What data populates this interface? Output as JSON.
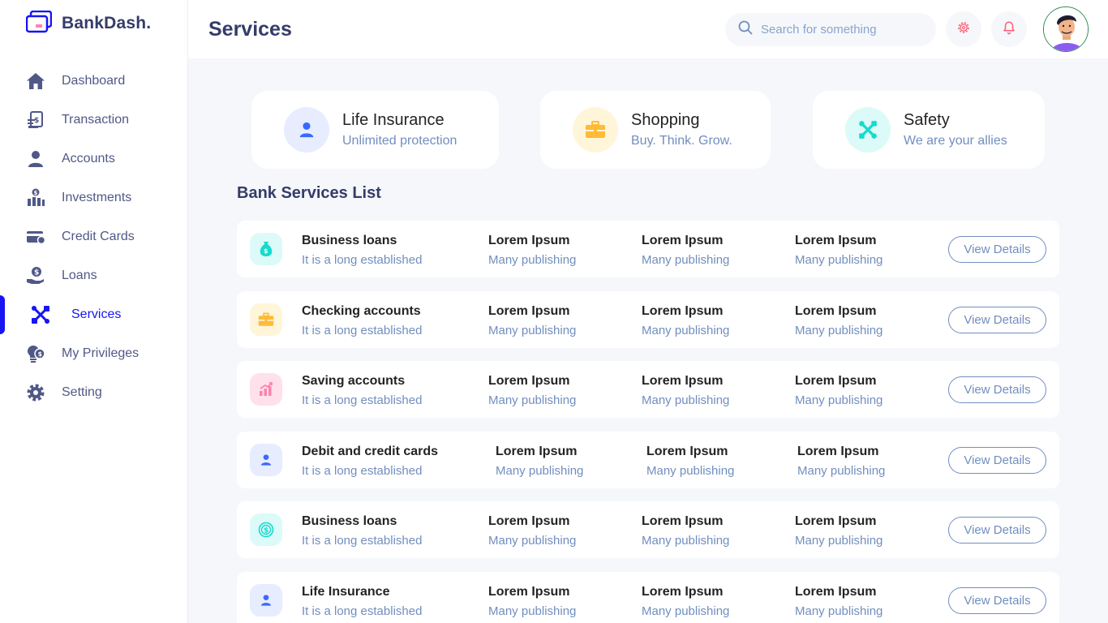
{
  "brand": {
    "name": "BankDash."
  },
  "header": {
    "title": "Services",
    "search_placeholder": "Search for something"
  },
  "sidebar": {
    "items": [
      {
        "label": "Dashboard",
        "icon": "home-icon",
        "active": false
      },
      {
        "label": "Transaction",
        "icon": "transfer-icon",
        "active": false
      },
      {
        "label": "Accounts",
        "icon": "user-icon",
        "active": false
      },
      {
        "label": "Investments",
        "icon": "investment-icon",
        "active": false
      },
      {
        "label": "Credit Cards",
        "icon": "credit-card-icon",
        "active": false
      },
      {
        "label": "Loans",
        "icon": "loan-icon",
        "active": false
      },
      {
        "label": "Services",
        "icon": "service-icon",
        "active": true
      },
      {
        "label": "My Privileges",
        "icon": "privilege-icon",
        "active": false
      },
      {
        "label": "Setting",
        "icon": "gear-icon",
        "active": false
      }
    ]
  },
  "top_cards": [
    {
      "title": "Life Insurance",
      "subtitle": "Unlimited protection",
      "icon": "user-icon",
      "icon_bg": "#E7EDFF",
      "icon_color": "#396AFF"
    },
    {
      "title": "Shopping",
      "subtitle": "Buy. Think. Grow.",
      "icon": "briefcase-icon",
      "icon_bg": "#FFF5D9",
      "icon_color": "#FFBB38"
    },
    {
      "title": "Safety",
      "subtitle": "We are your allies",
      "icon": "tools-icon",
      "icon_bg": "#DCFAF8",
      "icon_color": "#16DBCC"
    }
  ],
  "section_title": "Bank Services List",
  "services": [
    {
      "name": "Business loans",
      "desc": "It is a long established",
      "icon": "money-bag-icon",
      "icon_bg": "#FFE0EB",
      "icon_color": "#FF82AC",
      "cols": [
        {
          "title": "Lorem Ipsum",
          "sub": "Many publishing"
        },
        {
          "title": "Lorem Ipsum",
          "sub": "Many publishing"
        },
        {
          "title": "Lorem Ipsum",
          "sub": "Many publishing"
        }
      ],
      "button": "View Details"
    },
    {
      "name": "Checking accounts",
      "desc": "It is a long established",
      "icon": "briefcase-icon",
      "icon_bg": "#FFF5D9",
      "icon_color": "#FFBB38",
      "cols": [
        {
          "title": "Lorem Ipsum",
          "sub": "Many publishing"
        },
        {
          "title": "Lorem Ipsum",
          "sub": "Many publishing"
        },
        {
          "title": "Lorem Ipsum",
          "sub": "Many publishing"
        }
      ],
      "button": "View Details"
    },
    {
      "name": "Saving accounts",
      "desc": "It is a long established",
      "icon": "chart-icon",
      "icon_bg": "#FFE0EB",
      "icon_color": "#FF82AC",
      "cols": [
        {
          "title": "Lorem Ipsum",
          "sub": "Many publishing"
        },
        {
          "title": "Lorem Ipsum",
          "sub": "Many publishing"
        },
        {
          "title": "Lorem Ipsum",
          "sub": "Many publishing"
        }
      ],
      "button": "View Details"
    },
    {
      "name": "Debit and credit cards",
      "desc": "It is a long established",
      "icon": "user-icon",
      "icon_bg": "#E7EDFF",
      "icon_color": "#396AFF",
      "cols": [
        {
          "title": "Lorem Ipsum",
          "sub": "Many publishing"
        },
        {
          "title": "Lorem Ipsum",
          "sub": "Many publishing"
        },
        {
          "title": "Lorem Ipsum",
          "sub": "Many publishing"
        }
      ],
      "button": "View Details"
    },
    {
      "name": "Business loans",
      "desc": "It is a long established",
      "icon": "dollar-coin-icon",
      "icon_bg": "#DCFAF8",
      "icon_color": "#16DBCC",
      "cols": [
        {
          "title": "Lorem Ipsum",
          "sub": "Many publishing"
        },
        {
          "title": "Lorem Ipsum",
          "sub": "Many publishing"
        },
        {
          "title": "Lorem Ipsum",
          "sub": "Many publishing"
        }
      ],
      "button": "View Details"
    },
    {
      "name": "Life Insurance",
      "desc": "It is a long established",
      "icon": "user-icon",
      "icon_bg": "#E7EDFF",
      "icon_color": "#396AFF",
      "cols": [
        {
          "title": "Lorem Ipsum",
          "sub": "Many publishing"
        },
        {
          "title": "Lorem Ipsum",
          "sub": "Many publishing"
        },
        {
          "title": "Lorem Ipsum",
          "sub": "Many publishing"
        }
      ],
      "button": "View Details"
    }
  ],
  "colors": {
    "accent": "#1814F3",
    "sidebar_text": "#505887",
    "muted": "#718EBF",
    "heading": "#343C6A",
    "background": "#F5F7FA"
  }
}
